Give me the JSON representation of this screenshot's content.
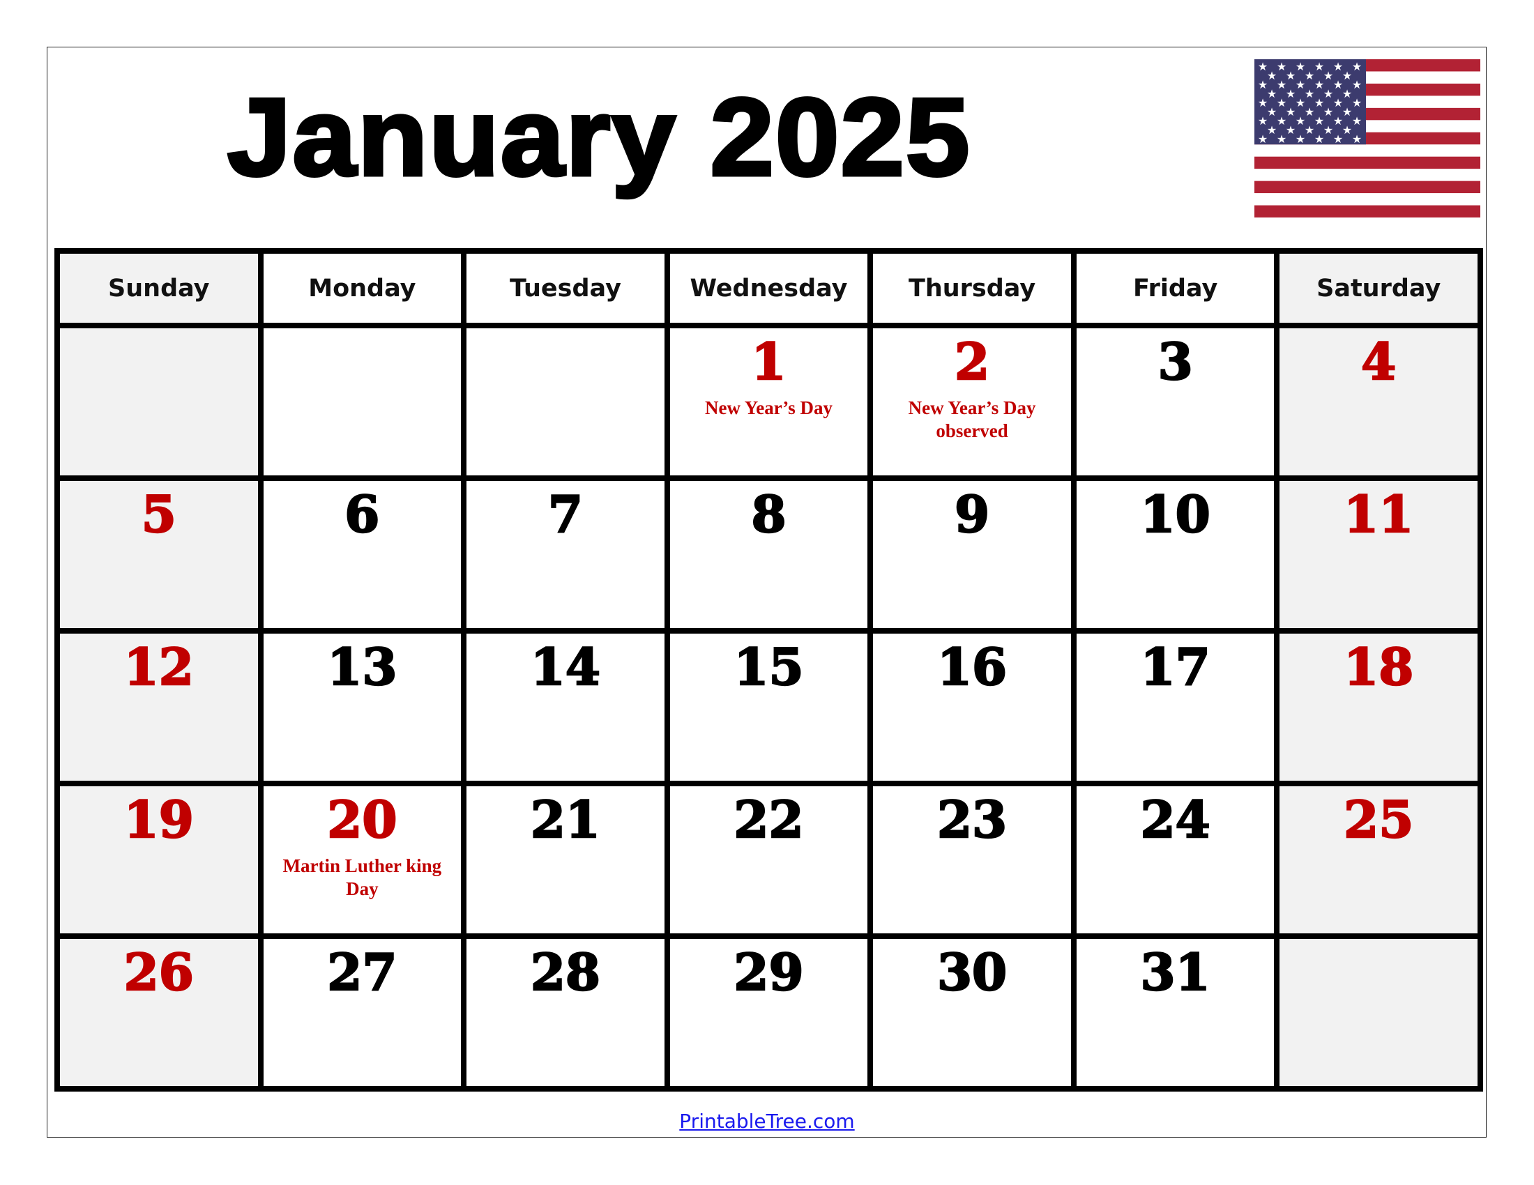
{
  "title": "January 2025",
  "flag": {
    "icon": "us-flag-icon",
    "colors": {
      "red": "#b22234",
      "blue": "#3c3b6e",
      "white": "#ffffff"
    }
  },
  "colors": {
    "holiday_red": "#c00000",
    "weekend_fill": "#f2f2f2",
    "link_blue": "#1a1aee"
  },
  "weekdays": [
    "Sunday",
    "Monday",
    "Tuesday",
    "Wednesday",
    "Thursday",
    "Friday",
    "Saturday"
  ],
  "weeks": [
    [
      {
        "day": ""
      },
      {
        "day": ""
      },
      {
        "day": ""
      },
      {
        "day": "1",
        "red": true,
        "holiday": "New Year’s Day"
      },
      {
        "day": "2",
        "red": true,
        "holiday": "New Year’s Day observed"
      },
      {
        "day": "3"
      },
      {
        "day": "4",
        "red": true
      }
    ],
    [
      {
        "day": "5",
        "red": true
      },
      {
        "day": "6"
      },
      {
        "day": "7"
      },
      {
        "day": "8"
      },
      {
        "day": "9"
      },
      {
        "day": "10"
      },
      {
        "day": "11",
        "red": true
      }
    ],
    [
      {
        "day": "12",
        "red": true
      },
      {
        "day": "13"
      },
      {
        "day": "14"
      },
      {
        "day": "15"
      },
      {
        "day": "16"
      },
      {
        "day": "17"
      },
      {
        "day": "18",
        "red": true
      }
    ],
    [
      {
        "day": "19",
        "red": true
      },
      {
        "day": "20",
        "red": true,
        "holiday": "Martin Luther king Day"
      },
      {
        "day": "21"
      },
      {
        "day": "22"
      },
      {
        "day": "23"
      },
      {
        "day": "24"
      },
      {
        "day": "25",
        "red": true
      }
    ],
    [
      {
        "day": "26",
        "red": true
      },
      {
        "day": "27"
      },
      {
        "day": "28"
      },
      {
        "day": "29"
      },
      {
        "day": "30"
      },
      {
        "day": "31"
      },
      {
        "day": ""
      }
    ]
  ],
  "footer": {
    "link_text": "PrintableTree.com"
  }
}
